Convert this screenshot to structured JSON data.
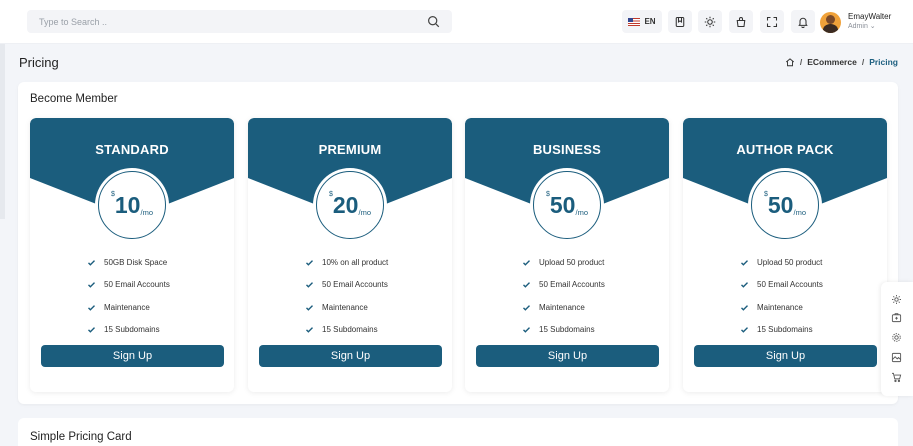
{
  "header": {
    "search_placeholder": "Type to Search ..",
    "language": "EN",
    "user_name": "EmayWalter",
    "user_role": "Admin"
  },
  "page": {
    "title": "Pricing",
    "breadcrumb": [
      "ECommerce",
      "Pricing"
    ]
  },
  "main_card": {
    "title": "Become Member",
    "plans": [
      {
        "name": "STANDARD",
        "currency": "$",
        "price": "10",
        "period": "/mo",
        "features": [
          "50GB Disk Space",
          "50 Email Accounts",
          "Maintenance",
          "15 Subdomains"
        ],
        "button": "Sign Up"
      },
      {
        "name": "PREMIUM",
        "currency": "$",
        "price": "20",
        "period": "/mo",
        "features": [
          "10% on all product",
          "50 Email Accounts",
          "Maintenance",
          "15 Subdomains"
        ],
        "button": "Sign Up"
      },
      {
        "name": "BUSINESS",
        "currency": "$",
        "price": "50",
        "period": "/mo",
        "features": [
          "Upload 50 product",
          "50 Email Accounts",
          "Maintenance",
          "15 Subdomains"
        ],
        "button": "Sign Up"
      },
      {
        "name": "AUTHOR PACK",
        "currency": "$",
        "price": "50",
        "period": "/mo",
        "features": [
          "Upload 50 product",
          "50 Email Accounts",
          "Maintenance",
          "15 Subdomains"
        ],
        "button": "Sign Up"
      }
    ]
  },
  "second_card": {
    "title": "Simple Pricing Card"
  },
  "colors": {
    "brand": "#1b5d7d",
    "background": "#f3f5f9",
    "card": "#ffffff"
  },
  "icons": {
    "header": [
      "search-icon",
      "flag-us-icon",
      "bookmark-icon",
      "sun-icon",
      "shopping-bag-icon",
      "fullscreen-icon",
      "bell-icon"
    ],
    "sidetools": [
      "settings-icon",
      "medical-kit-icon",
      "gear-icon",
      "image-icon",
      "cart-icon"
    ]
  }
}
